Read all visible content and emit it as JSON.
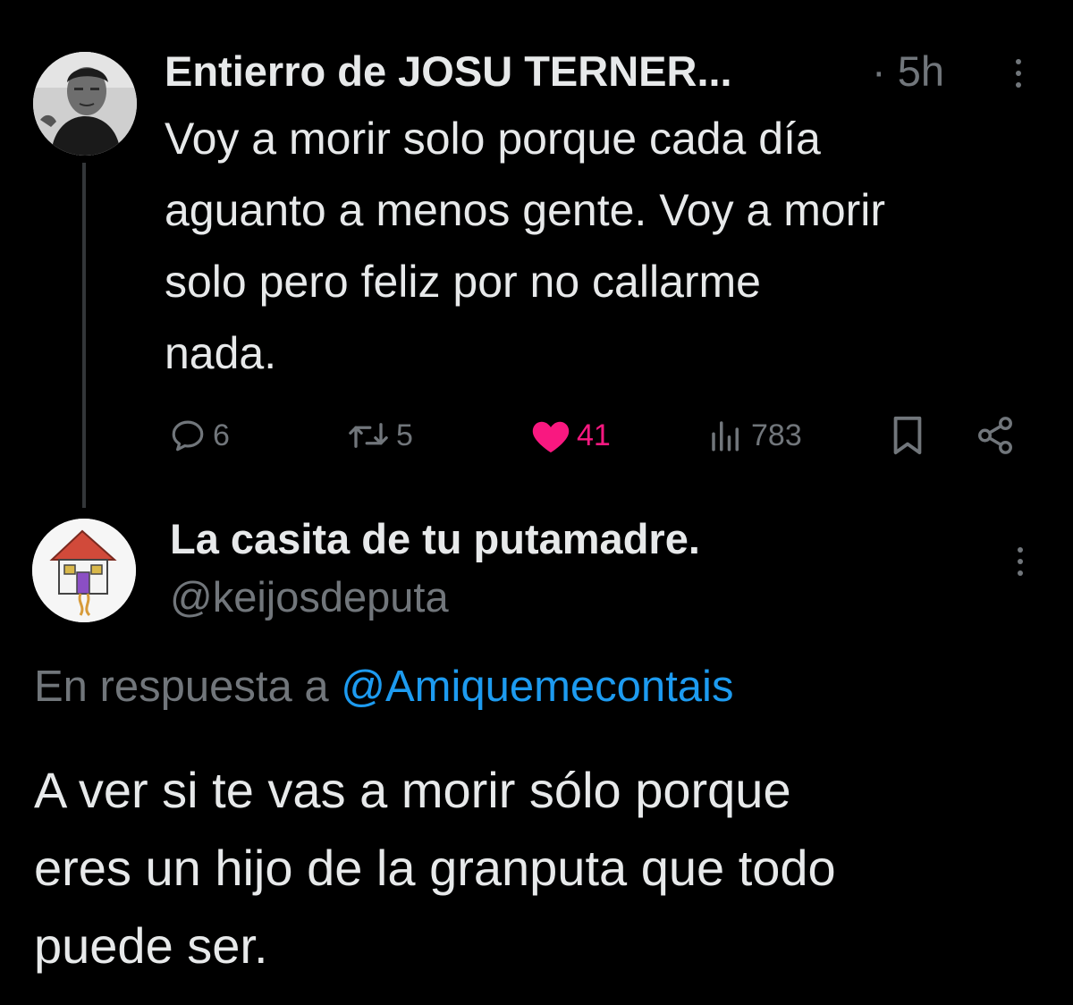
{
  "tweet": {
    "author_name": "Entierro de JOSU TERNER...",
    "separator": "·",
    "time": "5h",
    "text_lines": [
      "Voy a morir solo porque cada día",
      "aguanto a menos gente. Voy a morir",
      "solo pero feliz por no callarme",
      "nada."
    ],
    "actions": {
      "replies": "6",
      "retweets": "5",
      "likes": "41",
      "views": "783"
    },
    "like_color": "#f91880"
  },
  "reply": {
    "author_name": "La casita de tu putamadre.",
    "handle": "@keijosdeputa",
    "reply_prefix": "En respuesta a",
    "reply_to": "@Amiquemecontais",
    "text_lines": [
      "A ver si te vas a morir sólo porque",
      "eres un hijo de la granputa que todo",
      "puede ser."
    ],
    "mention_color": "#1d9bf0"
  },
  "icons": [
    "profile-photo",
    "more-icon",
    "reply-icon",
    "retweet-icon",
    "heart-icon",
    "views-icon",
    "bookmark-icon",
    "share-icon",
    "house-drawing"
  ]
}
